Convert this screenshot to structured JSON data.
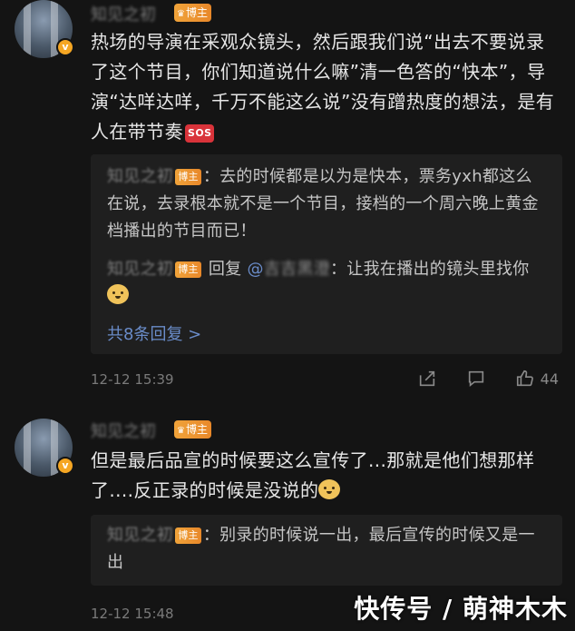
{
  "comments": [
    {
      "username": "知见之初",
      "badge": "博主",
      "text": "热场的导演在采观众镜头，然后跟我们说“出去不要说录了这个节目，你们知道说什么嘛”清一色答的“快本”，导演“达咩达咩，千万不能这么说”没有蹭热度的想法，是有人在带节奏",
      "emoji_badge": "SOS",
      "replies": [
        {
          "username": "知见之初",
          "badge": "博主",
          "text": "：去的时候都是以为是快本，票务yxh都这么在说，去录根本就不是一个节目，接档的一个周六晚上黄金档播出的节目而已！"
        },
        {
          "username": "知见之初",
          "badge": "博主",
          "prefix": "回复",
          "mention": "@",
          "mention_blurred": "吉吉黑澄",
          "text": "：让我在播出的镜头里找你"
        }
      ],
      "more_replies": "共8条回复 >",
      "timestamp": "12-12 15:39",
      "like_count": "44"
    },
    {
      "username": "知见之初",
      "badge": "博主",
      "text": "但是最后品宣的时候要这么宣传了...那就是他们想那样了....反正录的时候是没说的",
      "replies": [
        {
          "username": "知见之初",
          "badge": "博主",
          "text": "：别录的时候说一出，最后宣传的时候又是一出"
        }
      ],
      "timestamp": "12-12 15:48"
    }
  ],
  "watermark": "快传号 / 萌神木木",
  "colors": {
    "background": "#141414",
    "badge": "#f0a33a",
    "link": "#6a8cc9",
    "sos": "#d9333a"
  }
}
